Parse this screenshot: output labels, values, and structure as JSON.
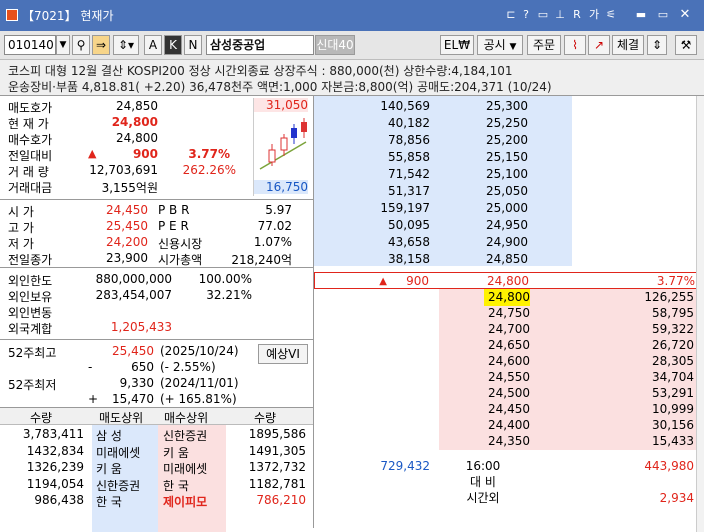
{
  "window": {
    "code_badge": "7021",
    "title": "현재가",
    "controls": [
      "中",
      "?",
      "ロ",
      "ュ",
      "R",
      "ㅤ가",
      "ㅡ"
    ]
  },
  "toolbar": {
    "stock_code": "010140",
    "stock_name": "삼성중공업",
    "badges": [
      "신대40"
    ],
    "font_buttons": [
      "A",
      "K",
      "N"
    ],
    "right_buttons": [
      "EL₩",
      "공시",
      "주문",
      "체결"
    ]
  },
  "info": {
    "line1": "코스피 대형 12월 결산 KOSPI200 정상   시간외종료  상장주식 : 880,000(천) 상한수량:4,184,101",
    "line2": "운송장비·부품  4,818.81(  +2.20) 36,478천주 액면:1,000 자본금:8,800(억) 공매도:204,371 (10/24)"
  },
  "quote": {
    "ask_label": "매도호가",
    "ask_value": "24,850",
    "current_label": "현 재 가",
    "current_value": "24,800",
    "bid_label": "매수호가",
    "bid_value": "24,800",
    "change_label": "전일대비",
    "change_arrow": "▲",
    "change_value": "900",
    "change_pct": "3.77%",
    "volume_label": "거 래 량",
    "volume_value": "12,703,691",
    "volume_pct": "262.26%",
    "amount_label": "거래대금",
    "amount_value": "3,155억원",
    "high_mark": "31,050",
    "low_mark": "16,750"
  },
  "ohlc": {
    "open_label": "시    가",
    "open_value": "24,450",
    "high_label": "고    가",
    "high_value": "25,450",
    "low_label": "저    가",
    "low_value": "24,200",
    "prev_label": "전일종가",
    "prev_value": "23,900",
    "pbr_label": "P B R",
    "pbr_value": "5.97",
    "per_label": "P E R",
    "per_value": "77.02",
    "credit_label": "신용시장",
    "credit_value": "1.07%",
    "mktcap_label": "시가총액",
    "mktcap_value": "218,240억"
  },
  "foreign": {
    "limit_label": "외인한도",
    "limit_value": "880,000,000",
    "limit_pct": "100.00%",
    "hold_label": "외인보유",
    "hold_value": "283,454,007",
    "hold_pct": "32.21%",
    "change_label": "외인변동",
    "total_label": "외국계합",
    "total_value": "1,205,433"
  },
  "week52": {
    "high_label": "52주최고",
    "high_value": "25,450",
    "high_date": "(2025/10/24)",
    "high_diff_sign": "-",
    "high_diff": "650",
    "high_diff_pct": "(-    2.55%)",
    "low_label": "52주최저",
    "low_value": "9,330",
    "low_date": "(2024/11/01)",
    "low_diff_sign": "+",
    "low_diff": "15,470",
    "low_diff_pct": "(+  165.81%)",
    "forecast_button": "예상VI"
  },
  "broker": {
    "headers": [
      "수량",
      "매도상위",
      "매수상위",
      "수량"
    ],
    "rows": [
      {
        "sell_qty": "3,783,411",
        "sell_name": "삼    성",
        "buy_name": "신한증권",
        "buy_qty": "1895,586"
      },
      {
        "sell_qty": "1432,834",
        "sell_name": "미래에셋",
        "buy_name": "키    움",
        "buy_qty": "1491,305"
      },
      {
        "sell_qty": "1326,239",
        "sell_name": "키    움",
        "buy_name": "미래에셋",
        "buy_qty": "1372,732"
      },
      {
        "sell_qty": "1194,054",
        "sell_name": "신한증권",
        "buy_name": "한    국",
        "buy_qty": "1182,781"
      },
      {
        "sell_qty": "986,438",
        "sell_name": "한    국",
        "buy_name": "제이피모",
        "buy_qty": "786,210"
      }
    ]
  },
  "book": {
    "asks": [
      {
        "qty": "140,569",
        "price": "25,300"
      },
      {
        "qty": "40,182",
        "price": "25,250"
      },
      {
        "qty": "78,856",
        "price": "25,200"
      },
      {
        "qty": "55,858",
        "price": "25,150"
      },
      {
        "qty": "71,542",
        "price": "25,100"
      },
      {
        "qty": "51,317",
        "price": "25,050"
      },
      {
        "qty": "159,197",
        "price": "25,000"
      },
      {
        "qty": "50,095",
        "price": "24,950"
      },
      {
        "qty": "43,658",
        "price": "24,900"
      },
      {
        "qty": "38,158",
        "price": "24,850"
      }
    ],
    "current": {
      "arrow": "▲",
      "change": "900",
      "price": "24,800",
      "pct": "3.77%"
    },
    "bids": [
      {
        "price": "24,800",
        "qty": "126,255"
      },
      {
        "price": "24,750",
        "qty": "58,795"
      },
      {
        "price": "24,700",
        "qty": "59,322"
      },
      {
        "price": "24,650",
        "qty": "26,720"
      },
      {
        "price": "24,600",
        "qty": "28,305"
      },
      {
        "price": "24,550",
        "qty": "34,704"
      },
      {
        "price": "24,500",
        "qty": "53,291"
      },
      {
        "price": "24,450",
        "qty": "10,999"
      },
      {
        "price": "24,400",
        "qty": "30,156"
      },
      {
        "price": "24,350",
        "qty": "15,433"
      }
    ],
    "totals": {
      "ask_total": "729,432",
      "time": "16:00",
      "bid_total": "443,980"
    },
    "vi_label": "대    비",
    "after_label": "시간외",
    "after_value": "2,934"
  },
  "colors": {
    "up": "#e0251b",
    "down": "#1a58c4",
    "ask_bg": "#dbe8fb",
    "bid_bg": "#fbe0e0",
    "titlebar": "#4a72b8"
  }
}
